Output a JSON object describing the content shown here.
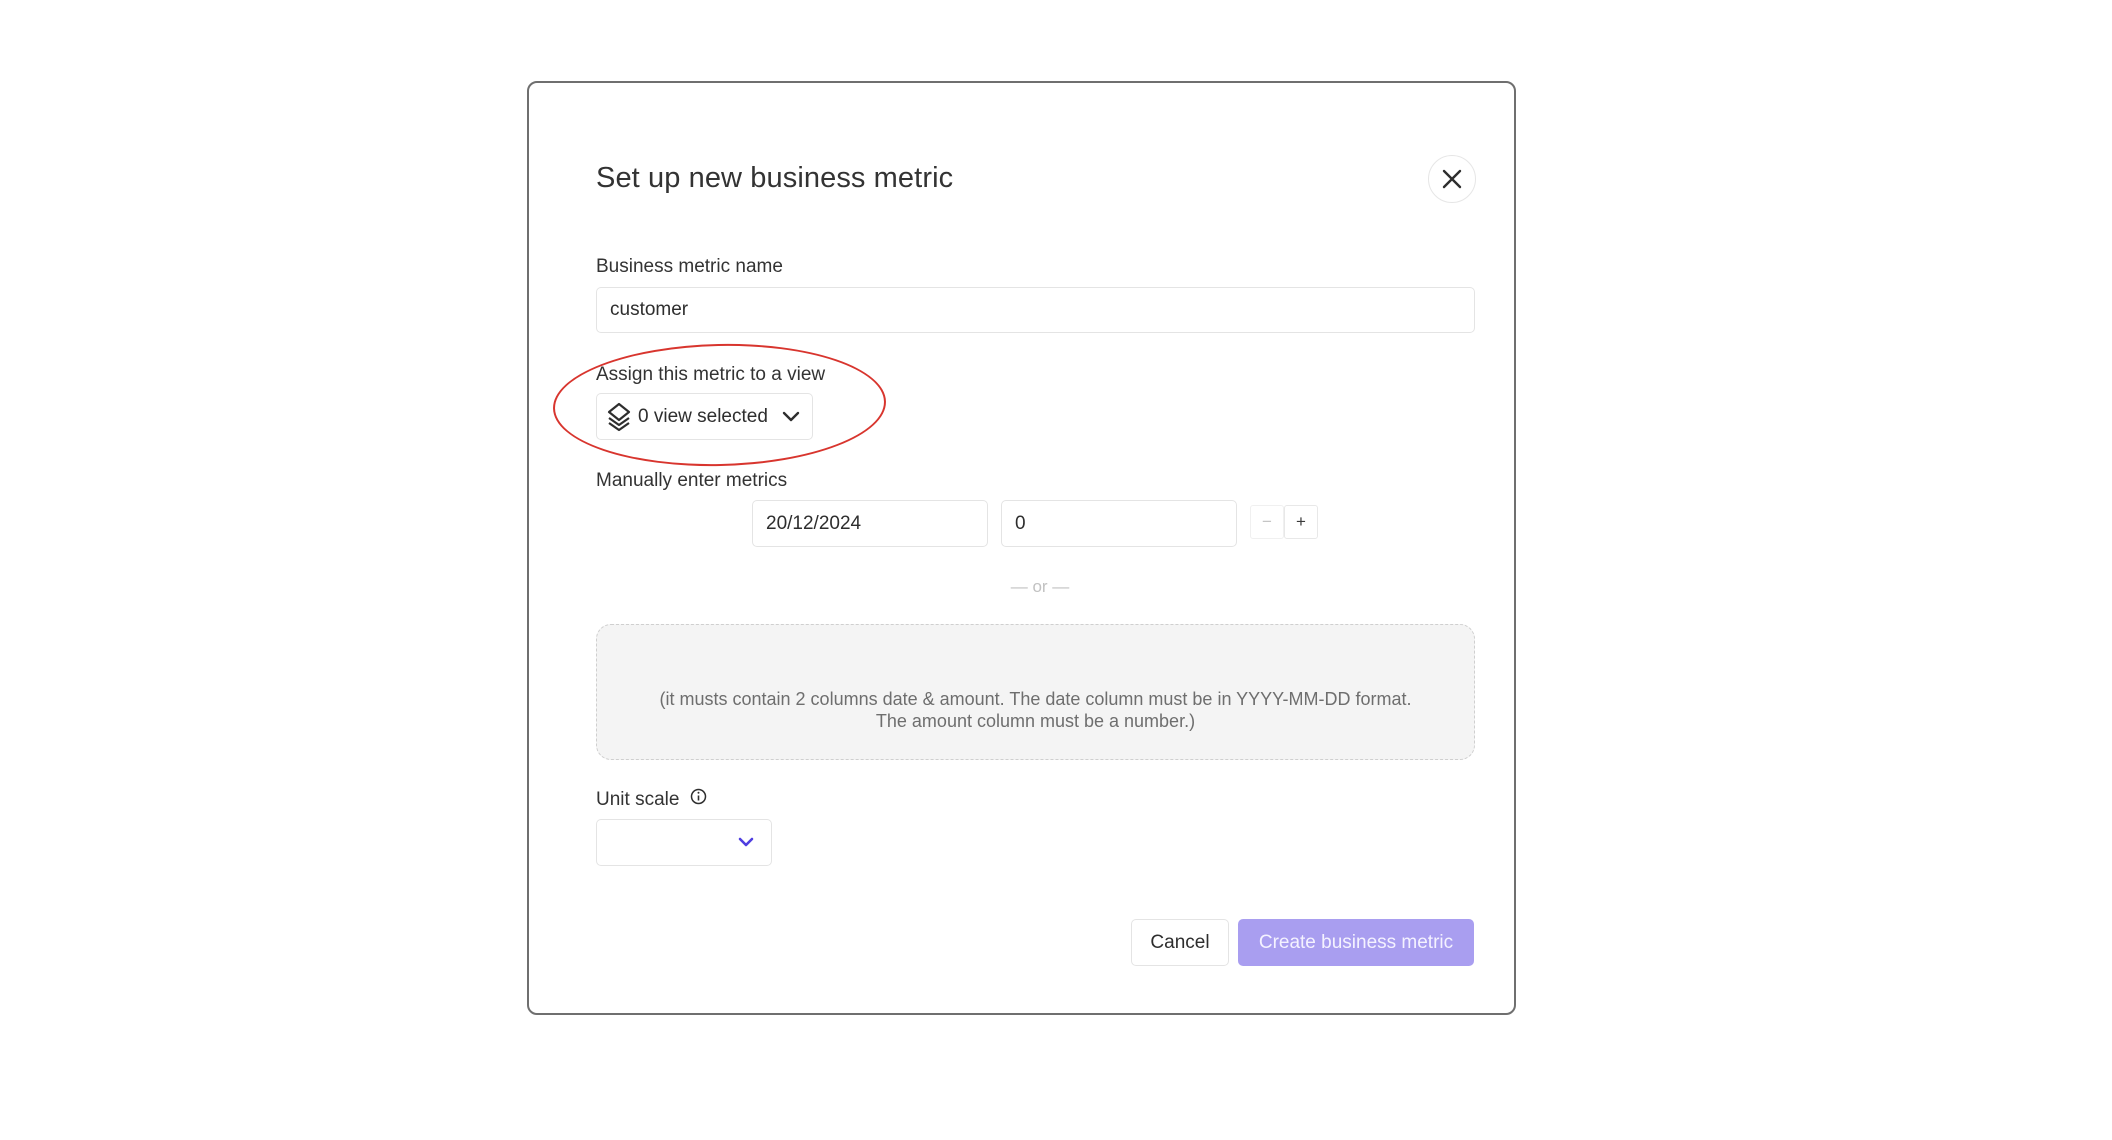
{
  "modal": {
    "title": "Set up new business metric",
    "close_icon": "close-icon"
  },
  "name_field": {
    "label": "Business metric name",
    "value": "customer"
  },
  "view_assign": {
    "label": "Assign this metric to a view",
    "button_label": "0 view selected",
    "icon": "layers-icon",
    "chevron_icon": "chevron-down-icon",
    "annotation_color": "#d8352e"
  },
  "manual_entry": {
    "label": "Manually enter metrics",
    "date_value": "20/12/2024",
    "amount_value": "0",
    "decrement_label": "−",
    "increment_label": "+"
  },
  "divider": {
    "text": "— or —"
  },
  "upload": {
    "hint": "(it musts contain 2 columns date & amount. The date column must be in YYYY-MM-DD format. The amount column must be a number.)"
  },
  "unit_scale": {
    "label": "Unit scale",
    "info_icon": "info-icon",
    "selected_value": "",
    "chevron_color": "#4f3ee0"
  },
  "footer": {
    "cancel_label": "Cancel",
    "create_label": "Create business metric",
    "create_color": "#a99ef0"
  }
}
